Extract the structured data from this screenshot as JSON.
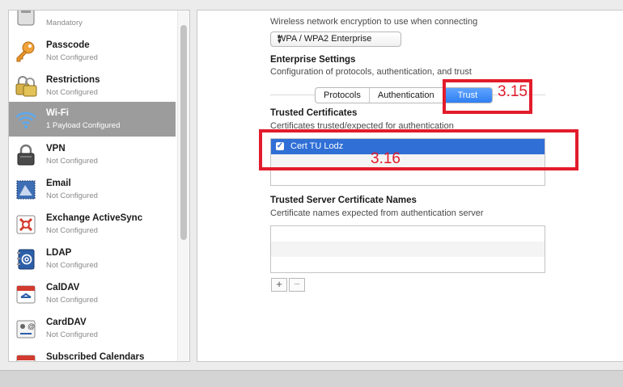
{
  "sidebar": {
    "items": [
      {
        "title": "",
        "subtitle": "Mandatory",
        "icon": "general-icon"
      },
      {
        "title": "Passcode",
        "subtitle": "Not Configured",
        "icon": "key-icon"
      },
      {
        "title": "Restrictions",
        "subtitle": "Not Configured",
        "icon": "padlocks-icon"
      },
      {
        "title": "Wi-Fi",
        "subtitle": "1 Payload Configured",
        "icon": "wifi-icon",
        "selected": true
      },
      {
        "title": "VPN",
        "subtitle": "Not Configured",
        "icon": "vpn-lock-icon"
      },
      {
        "title": "Email",
        "subtitle": "Not Configured",
        "icon": "email-stamp-icon"
      },
      {
        "title": "Exchange ActiveSync",
        "subtitle": "Not Configured",
        "icon": "exchange-icon"
      },
      {
        "title": "LDAP",
        "subtitle": "Not Configured",
        "icon": "ldap-icon"
      },
      {
        "title": "CalDAV",
        "subtitle": "Not Configured",
        "icon": "caldav-icon"
      },
      {
        "title": "CardDAV",
        "subtitle": "Not Configured",
        "icon": "carddav-icon"
      },
      {
        "title": "Subscribed Calendars",
        "subtitle": "",
        "icon": "subscribed-calendars-icon"
      }
    ]
  },
  "security": {
    "description": "Wireless network encryption to use when connecting",
    "selected": "WPA / WPA2 Enterprise"
  },
  "enterprise": {
    "title": "Enterprise Settings",
    "description": "Configuration of protocols, authentication, and trust",
    "tabs": [
      "Protocols",
      "Authentication",
      "Trust"
    ],
    "active_tab": "Trust"
  },
  "trusted_certs": {
    "title": "Trusted Certificates",
    "description": "Certificates trusted/expected for authentication",
    "items": [
      {
        "label": "Cert TU Lodz",
        "checked": true
      }
    ]
  },
  "trusted_names": {
    "title": "Trusted Server Certificate Names",
    "description": "Certificate names expected from authentication server",
    "add_label": "+",
    "remove_label": "−"
  },
  "annotations": {
    "trust_tab": "3.15",
    "cert_row": "3.16",
    "color": "#e21c2c"
  },
  "colors": {
    "accent": "#2f7ff2",
    "selection": "#2f6fd6",
    "sidebar_selected": "#9c9c9c"
  }
}
